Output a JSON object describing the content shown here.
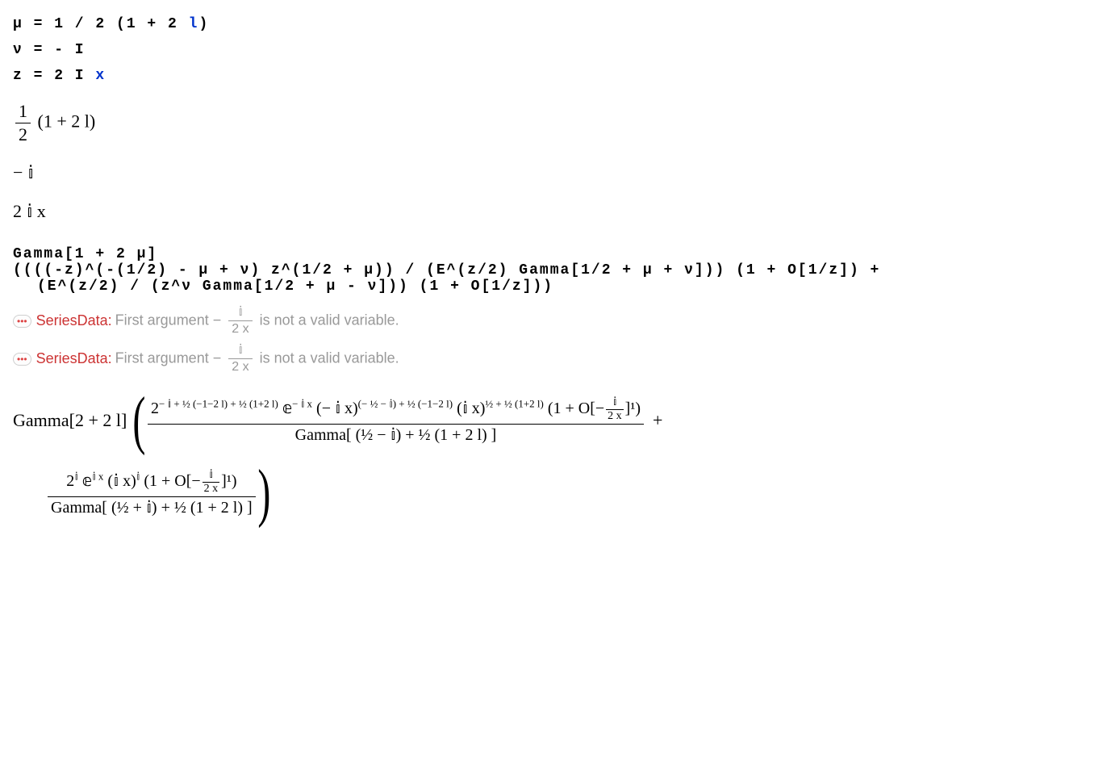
{
  "input1": "μ = 1 / 2  (1 + 2 ",
  "input1_l": "l",
  "input1_end": ")",
  "input2": "ν = - I",
  "input3a": "z = 2  I ",
  "input3b": "x",
  "out1_frac_top": "1",
  "out1_frac_bot": "2",
  "out1_after": " (1 + 2 l)",
  "out2": "− 𝕚",
  "out3": "2 𝕚 x",
  "big_in_l1": "Gamma[1 + 2 μ]",
  "big_in_l2": " ((((-z)^(-(1/2) - μ + ν)  z^(1/2 + μ)) / (E^(z/2)  Gamma[1/2 + μ + ν]))  (1 + O[1/z]) +",
  "big_in_l3": "(E^(z/2) / (z^ν  Gamma[1/2 + μ - ν]))  (1 + O[1/z]))",
  "msg_tag": "SeriesData",
  "msg_colon": ":",
  "msg_text1": "First argument −",
  "msg_frac_top": "𝕚",
  "msg_frac_bot": "2 x",
  "msg_text2": "is not a valid variable.",
  "gamma_label": "Gamma[2 + 2 l]",
  "term1_top_p1": "2",
  "term1_top_sup1": "− 𝕚 + ½ (−1−2 l) + ½ (1+2 l)",
  "term1_top_e": " 𝕖",
  "term1_top_e_sup": "− 𝕚 x",
  "term1_top_p2": " (− 𝕚 x)",
  "term1_top_sup2": "(− ½ − 𝕚) + ½ (−1−2 l)",
  "term1_top_p3": " (𝕚 x)",
  "term1_top_sup3": "½ + ½ (1+2 l)",
  "term1_top_O": " (1 + O[−",
  "term1_top_O_frac_top": "𝕚",
  "term1_top_O_frac_bot": "2 x",
  "term1_top_O_end": "]¹)",
  "term1_bot": "Gamma[ (½ − 𝕚) + ½ (1 + 2 l) ]",
  "plus": "+",
  "term2_top_a": "2",
  "term2_top_a_sup": "𝕚",
  "term2_top_e": " 𝕖",
  "term2_top_e_sup": "𝕚 x",
  "term2_top_b": " (𝕚 x)",
  "term2_top_b_sup": "𝕚",
  "term2_top_O": " (1 + O[−",
  "term2_top_O_frac_top": "𝕚",
  "term2_top_O_frac_bot": "2 x",
  "term2_top_O_end": "]¹)",
  "term2_bot": "Gamma[ (½ + 𝕚) + ½ (1 + 2 l) ]"
}
